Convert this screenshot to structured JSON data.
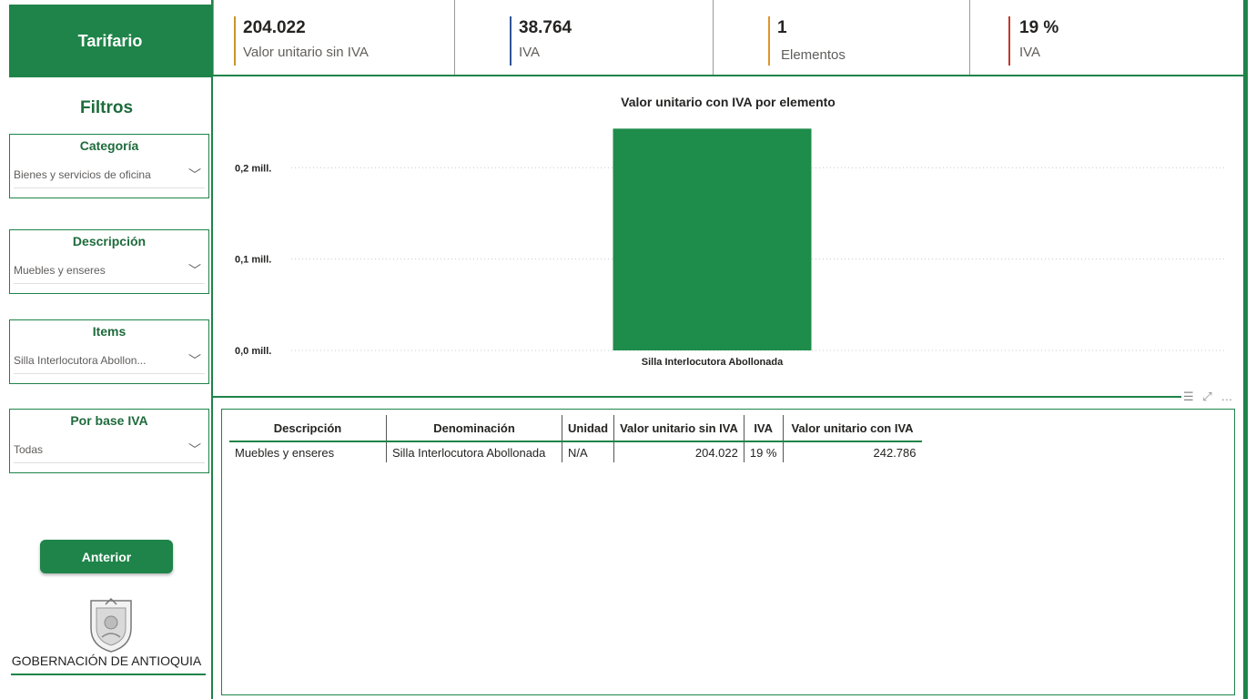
{
  "sidebar": {
    "title": "Tarifario",
    "filters_heading": "Filtros",
    "filters": [
      {
        "label": "Categoría",
        "value": "Bienes y servicios de oficina"
      },
      {
        "label": "Descripción",
        "value": "Muebles y enseres"
      },
      {
        "label": "Items",
        "value": "Silla Interlocutora Abollon..."
      },
      {
        "label": "Por base IVA",
        "value": "Todas"
      }
    ],
    "back_button": "Anterior",
    "org_name": "GOBERNACIÓN DE ANTIOQUIA"
  },
  "kpis": [
    {
      "value": "204.022",
      "label": "Valor unitario sin IVA",
      "color": "#c9952a"
    },
    {
      "value": "38.764",
      "label": "IVA",
      "color": "#2f5597"
    },
    {
      "value": "1",
      "label": "Elementos",
      "color": "#e0952a"
    },
    {
      "value": "19 %",
      "label": "IVA",
      "color": "#c0392b"
    }
  ],
  "colors": {
    "accent": "#1e8449",
    "bar": "#1e8c4a"
  },
  "icons": {
    "filter": "filter-icon",
    "focus": "focus-mode-icon",
    "more": "more-options-icon"
  },
  "chart_data": {
    "type": "bar",
    "title": "Valor unitario con IVA por elemento",
    "categories": [
      "Silla Interlocutora Abollonada"
    ],
    "values": [
      242786
    ],
    "y_ticks": [
      {
        "value": 0,
        "label": "0,0 mill."
      },
      {
        "value": 100000,
        "label": "0,1 mill."
      },
      {
        "value": 200000,
        "label": "0,2 mill."
      }
    ],
    "ylim": [
      0,
      250000
    ],
    "grid": true
  },
  "table": {
    "headers": [
      "Descripción",
      "Denominación",
      "Unidad",
      "Valor unitario sin IVA",
      "IVA",
      "Valor unitario con IVA"
    ],
    "rows": [
      [
        "Muebles y enseres",
        "Silla Interlocutora Abollonada",
        "N/A",
        "204.022",
        "19 %",
        "242.786"
      ]
    ]
  }
}
